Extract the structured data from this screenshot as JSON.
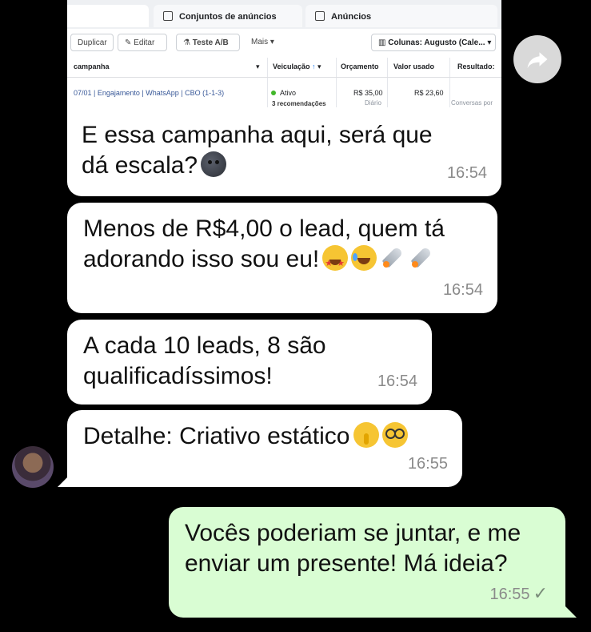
{
  "screenshot": {
    "tabs": [
      {
        "label": ""
      },
      {
        "label": "Conjuntos de anúncios"
      },
      {
        "label": "Anúncios"
      }
    ],
    "toolbar": {
      "duplicate": "Duplicar",
      "edit": "Editar",
      "ab_test": "Teste A/B",
      "more": "Mais",
      "columns": "Colunas: Augusto (Cale..."
    },
    "columns": {
      "campaign": "campanha",
      "delivery": "Veiculação",
      "budget": "Orçamento",
      "amount_spent": "Valor usado",
      "results": "Resultado:"
    },
    "row": {
      "name": "07/01 | Engajamento | WhatsApp | CBO (1-1-3)",
      "delivery_status": "Ativo",
      "recommendations": "3 recomendações",
      "budget": "R$ 35,00",
      "budget_period": "Diário",
      "amount_spent": "R$ 23,60",
      "results_type": "Conversas por"
    }
  },
  "messages": [
    {
      "text": "E essa campanha aqui, será que dá escala?",
      "time": "16:54",
      "emojis": [
        "new-moon-face"
      ]
    },
    {
      "text_line1": "Menos de R$4,00 o lead, quem tá",
      "text_line2": "adorando isso sou eu!",
      "time": "16:54",
      "emojis": [
        "star-struck",
        "tears-of-joy",
        "rocket",
        "rocket"
      ]
    },
    {
      "text_line1": "A cada 10 leads, 8 são",
      "text_line2": "qualificadíssimos!",
      "time": "16:54"
    },
    {
      "text": "Detalhe: Criativo estático",
      "time": "16:55",
      "emojis": [
        "shushing-face",
        "nerd-face"
      ]
    },
    {
      "text_line1": "Vocês poderiam se juntar, e me",
      "text_line2": "enviar um presente! Má ideia?",
      "time": "16:55",
      "status": "sent",
      "outgoing": true
    }
  ],
  "colors": {
    "incoming_bubble": "#ffffff",
    "outgoing_bubble": "#d9fdd3",
    "background": "#000000",
    "timestamp": "#8a8a8a",
    "link": "#385898",
    "active_green": "#42b72a"
  },
  "icons": [
    "forward-icon",
    "avatar",
    "check-icon"
  ]
}
